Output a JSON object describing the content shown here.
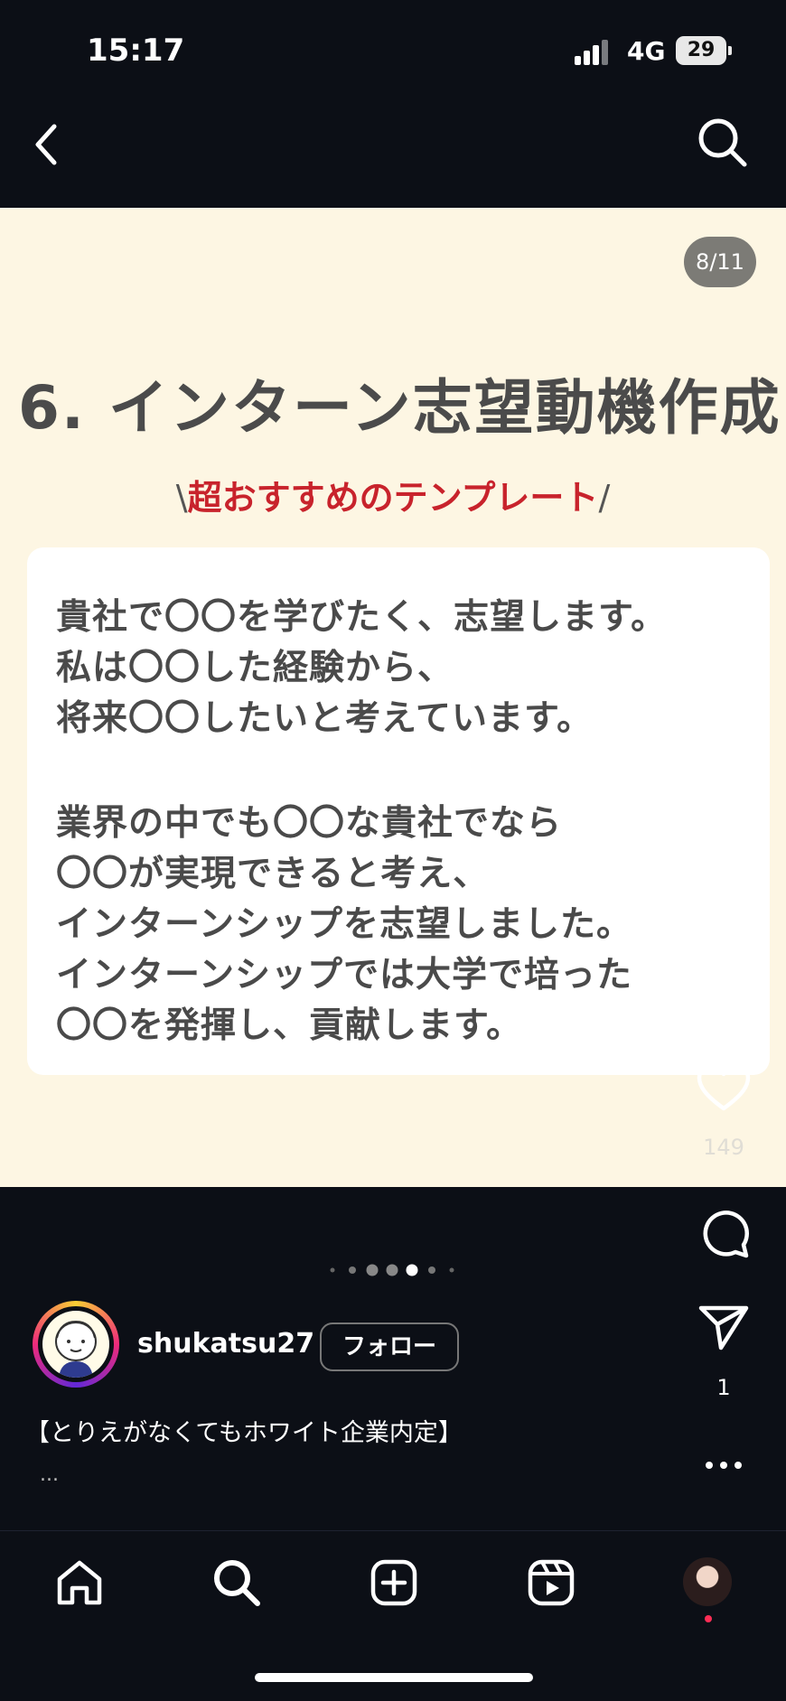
{
  "status_bar": {
    "time": "15:17",
    "network": "4G",
    "battery": "29"
  },
  "nav": {
    "back_icon": "chevron-left-icon",
    "search_icon": "search-icon"
  },
  "post": {
    "counter": "8/11",
    "title": "6. インターン志望動機作成",
    "subtitle_pre": "\\",
    "subtitle": "超おすすめのテンプレート",
    "subtitle_post": "/",
    "lines": [
      "貴社で〇〇を学びたく、志望します。",
      "私は〇〇した経験から、",
      "将来〇〇したいと考えています。",
      "業界の中でも〇〇な貴社でなら",
      "〇〇が実現できると考え、",
      "インターンシップを志望しました。",
      "インターンシップでは大学で培った",
      "〇〇を発揮し、貢献します。"
    ],
    "colors": {
      "background": "#fdf6e3",
      "title": "#4b4b4b",
      "accent": "#c8232c"
    }
  },
  "actions": {
    "like_count": "149",
    "share_count": "1"
  },
  "carousel": {
    "dot_count": 7,
    "active_index": 4
  },
  "user": {
    "username": "shukatsu27",
    "follow_label": "フォロー"
  },
  "caption": {
    "text": "【とりえがなくてもホワイト企業内定】",
    "more": "..."
  },
  "tabbar": {
    "items": [
      "home-icon",
      "search-icon",
      "create-icon",
      "reels-icon",
      "profile-avatar"
    ]
  }
}
